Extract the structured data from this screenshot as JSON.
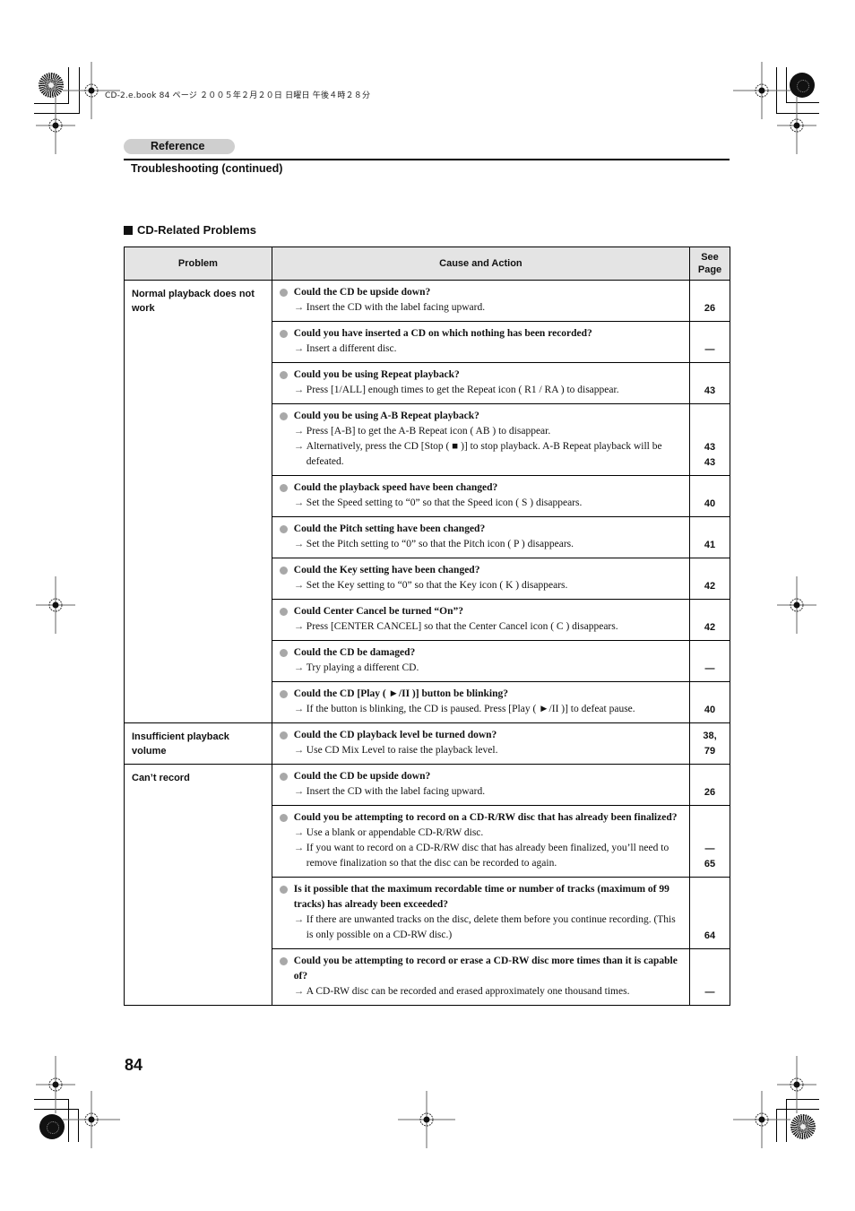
{
  "print_header": {
    "book_info": "CD-2.e.book  84 ページ  ２００５年２月２０日  日曜日  午後４時２８分"
  },
  "header": {
    "reference_tab": "Reference",
    "section_subtitle": "Troubleshooting (continued)"
  },
  "section": {
    "title": "CD-Related Problems"
  },
  "table": {
    "columns": [
      "Problem",
      "Cause and Action",
      "See Page"
    ],
    "groups": [
      {
        "problem": "Normal playback does not work",
        "rows": [
          {
            "question": "Could the CD be upside down?",
            "actions": [
              "Insert the CD with the label facing upward."
            ],
            "pages": [
              "26"
            ]
          },
          {
            "question": "Could you have inserted a CD on which nothing has been recorded?",
            "actions": [
              "Insert a different disc."
            ],
            "pages": [
              "—"
            ]
          },
          {
            "question": "Could you be using Repeat playback?",
            "actions": [
              "Press [1/ALL] enough times to get the Repeat icon ( R1 / RA ) to disappear."
            ],
            "pages": [
              "43"
            ]
          },
          {
            "question": "Could you be using A-B Repeat playback?",
            "actions": [
              "Press [A-B] to get the A-B Repeat icon ( AB ) to disappear.",
              "Alternatively, press the CD [Stop ( ■ )] to stop playback. A-B Repeat playback will be defeated."
            ],
            "pages": [
              "43",
              "43"
            ]
          },
          {
            "question": "Could the playback speed have been changed?",
            "actions": [
              "Set the Speed setting to “0” so that the Speed icon ( S ) disappears."
            ],
            "pages": [
              "40"
            ]
          },
          {
            "question": "Could the Pitch setting have been changed?",
            "actions": [
              "Set the Pitch setting to “0” so that the Pitch icon ( P ) disappears."
            ],
            "pages": [
              "41"
            ]
          },
          {
            "question": "Could the Key setting have been changed?",
            "actions": [
              "Set the Key setting to “0” so that the Key icon ( K ) disappears."
            ],
            "pages": [
              "42"
            ]
          },
          {
            "question": "Could Center Cancel be turned “On”?",
            "actions": [
              "Press [CENTER CANCEL] so that the Center Cancel icon ( C ) disappears."
            ],
            "pages": [
              "42"
            ]
          },
          {
            "question": "Could the CD be damaged?",
            "actions": [
              "Try playing a different CD."
            ],
            "pages": [
              "—"
            ]
          },
          {
            "question": "Could the CD [Play ( ►/II )] button be blinking?",
            "actions": [
              "If the button is blinking, the CD is paused. Press [Play ( ►/II )] to defeat pause."
            ],
            "pages": [
              "40"
            ]
          }
        ]
      },
      {
        "problem": "Insufficient playback volume",
        "rows": [
          {
            "question": "Could the CD playback level be turned down?",
            "actions": [
              "Use CD Mix Level to raise the playback level."
            ],
            "pages": [
              "38,",
              "79"
            ]
          }
        ]
      },
      {
        "problem": "Can’t record",
        "rows": [
          {
            "question": "Could the CD be upside down?",
            "actions": [
              "Insert the CD with the label facing upward."
            ],
            "pages": [
              "26"
            ]
          },
          {
            "question": "Could you be attempting to record on a CD-R/RW disc that has already been finalized?",
            "actions": [
              "Use a blank or appendable CD-R/RW disc.",
              "If you want to record on a CD-R/RW disc that has already been finalized, you’ll need to remove finalization so that the disc can be recorded to again."
            ],
            "pages": [
              "—",
              "65"
            ]
          },
          {
            "question": "Is it possible that the maximum recordable time or number of tracks (maximum of 99 tracks) has already been exceeded?",
            "actions": [
              "If there are unwanted tracks on the disc, delete them before you continue recording. (This is only possible on a CD-RW disc.)"
            ],
            "pages": [
              "64"
            ]
          },
          {
            "question": "Could you be attempting to record or erase a CD-RW disc more times than it is capable of?",
            "actions": [
              "A CD-RW disc can be recorded and erased approximately one thousand times."
            ],
            "pages": [
              "—"
            ]
          }
        ]
      }
    ]
  },
  "footer": {
    "page_number": "84"
  },
  "icons": {
    "bullet": "gray-dot",
    "action": "→"
  }
}
